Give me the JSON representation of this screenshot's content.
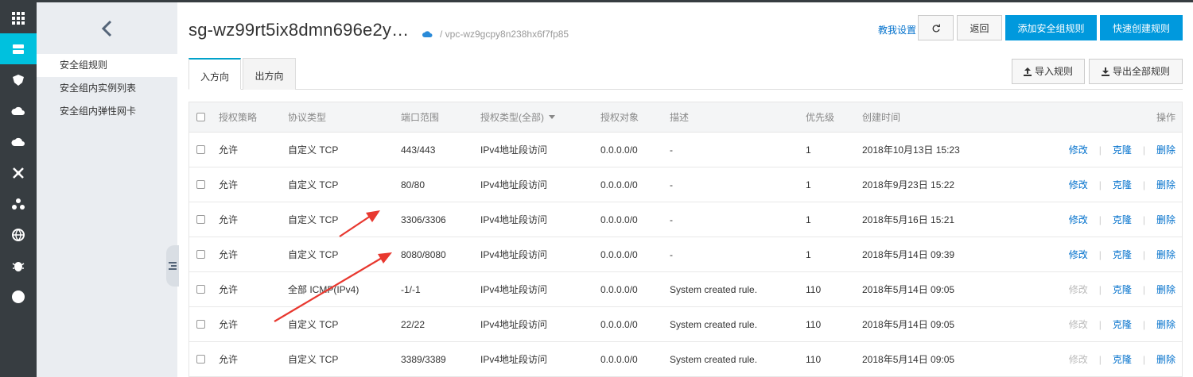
{
  "sidebar": {
    "rail_icons": [
      "grid-icon",
      "server-icon",
      "shield-icon",
      "cloud-upload-icon",
      "cloud-download-icon",
      "network-icon",
      "cluster-icon",
      "globe-icon",
      "bug-icon",
      "circle-icon"
    ],
    "items": [
      {
        "label": "安全组规则"
      },
      {
        "label": "安全组内实例列表"
      },
      {
        "label": "安全组内弹性网卡"
      }
    ]
  },
  "header": {
    "title": "sg-wz99rt5ix8dmn696e2y…",
    "vpc": "/ vpc-wz9gcpy8n238hx6f7fp85",
    "help_link": "教我设置",
    "back_label": "返回",
    "add_rule_label": "添加安全组规则",
    "quick_create_label": "快速创建规则"
  },
  "tabs": [
    {
      "label": "入方向"
    },
    {
      "label": "出方向"
    }
  ],
  "toolbar": {
    "import_label": "导入规则",
    "export_label": "导出全部规则"
  },
  "table": {
    "headers": {
      "policy": "授权策略",
      "protocol": "协议类型",
      "port": "端口范围",
      "auth_type": "授权类型(全部)",
      "object": "授权对象",
      "desc": "描述",
      "priority": "优先级",
      "created": "创建时间",
      "ops": "操作"
    },
    "ops_labels": {
      "edit": "修改",
      "clone": "克隆",
      "delete": "删除"
    },
    "rows": [
      {
        "policy": "允许",
        "protocol": "自定义 TCP",
        "port": "443/443",
        "auth_type": "IPv4地址段访问",
        "object": "0.0.0.0/0",
        "desc": "-",
        "priority": "1",
        "created": "2018年10月13日 15:23",
        "edit_enabled": true
      },
      {
        "policy": "允许",
        "protocol": "自定义 TCP",
        "port": "80/80",
        "auth_type": "IPv4地址段访问",
        "object": "0.0.0.0/0",
        "desc": "-",
        "priority": "1",
        "created": "2018年9月23日 15:22",
        "edit_enabled": true
      },
      {
        "policy": "允许",
        "protocol": "自定义 TCP",
        "port": "3306/3306",
        "auth_type": "IPv4地址段访问",
        "object": "0.0.0.0/0",
        "desc": "-",
        "priority": "1",
        "created": "2018年5月16日 15:21",
        "edit_enabled": true
      },
      {
        "policy": "允许",
        "protocol": "自定义 TCP",
        "port": "8080/8080",
        "auth_type": "IPv4地址段访问",
        "object": "0.0.0.0/0",
        "desc": "-",
        "priority": "1",
        "created": "2018年5月14日 09:39",
        "edit_enabled": true
      },
      {
        "policy": "允许",
        "protocol": "全部 ICMP(IPv4)",
        "port": "-1/-1",
        "auth_type": "IPv4地址段访问",
        "object": "0.0.0.0/0",
        "desc": "System created rule.",
        "priority": "110",
        "created": "2018年5月14日 09:05",
        "edit_enabled": false
      },
      {
        "policy": "允许",
        "protocol": "自定义 TCP",
        "port": "22/22",
        "auth_type": "IPv4地址段访问",
        "object": "0.0.0.0/0",
        "desc": "System created rule.",
        "priority": "110",
        "created": "2018年5月14日 09:05",
        "edit_enabled": false
      },
      {
        "policy": "允许",
        "protocol": "自定义 TCP",
        "port": "3389/3389",
        "auth_type": "IPv4地址段访问",
        "object": "0.0.0.0/0",
        "desc": "System created rule.",
        "priority": "110",
        "created": "2018年5月14日 09:05",
        "edit_enabled": false
      }
    ]
  },
  "colors": {
    "accent": "#00c1de",
    "primary_button": "#0099dd",
    "link": "#0070cc",
    "annotation_arrow": "#e8382f"
  }
}
